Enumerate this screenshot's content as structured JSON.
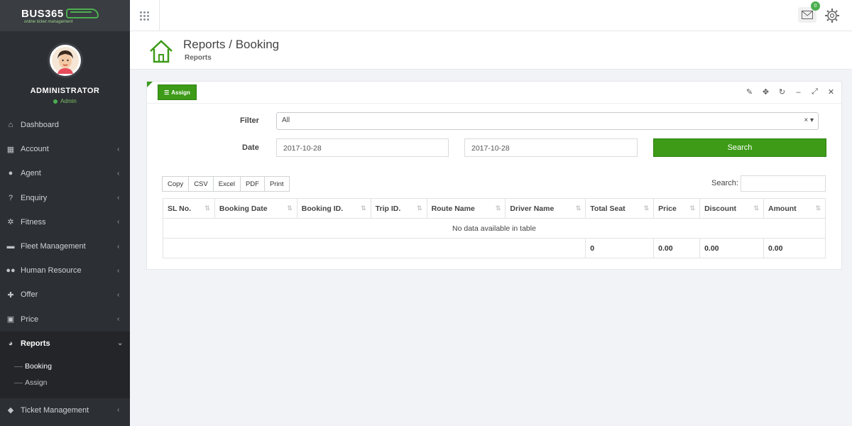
{
  "logo": {
    "name": "BUS365",
    "tagline": "online ticket management"
  },
  "profile": {
    "name": "ADMINISTRATOR",
    "role": "Admin"
  },
  "sidebar": {
    "items": [
      {
        "label": "Dashboard",
        "icon": "home-icon"
      },
      {
        "label": "Account",
        "icon": "calculator-icon"
      },
      {
        "label": "Agent",
        "icon": "user-icon"
      },
      {
        "label": "Enquiry",
        "icon": "question-icon"
      },
      {
        "label": "Fitness",
        "icon": "cog-icon"
      },
      {
        "label": "Fleet Management",
        "icon": "car-icon"
      },
      {
        "label": "Human Resource",
        "icon": "users-icon"
      },
      {
        "label": "Offer",
        "icon": "gift-icon"
      },
      {
        "label": "Price",
        "icon": "money-icon"
      },
      {
        "label": "Reports",
        "icon": "pie-chart-icon"
      }
    ],
    "reports_sub": [
      {
        "label": "Booking"
      },
      {
        "label": "Assign"
      }
    ],
    "ticket": {
      "label": "Ticket Management",
      "icon": "ticket-icon"
    }
  },
  "topbar": {
    "mail_count": "0"
  },
  "header": {
    "title": "Reports / Booking",
    "subtitle": "Reports"
  },
  "panel": {
    "assign_label": "Assign",
    "filter_label": "Filter",
    "filter_value": "All",
    "filter_clear": "×",
    "date_label": "Date",
    "date_from": "2017-10-28",
    "date_to": "2017-10-28",
    "search_button": "Search",
    "export_buttons": [
      "Copy",
      "CSV",
      "Excel",
      "PDF",
      "Print"
    ],
    "search_label": "Search:"
  },
  "table": {
    "headers": [
      "SL No.",
      "Booking Date",
      "Booking ID.",
      "Trip ID.",
      "Route Name",
      "Driver Name",
      "Total Seat",
      "Price",
      "Discount",
      "Amount"
    ],
    "empty_message": "No data available in table",
    "totals": {
      "total_seat": "0",
      "price": "0.00",
      "discount": "0.00",
      "amount": "0.00"
    }
  },
  "colors": {
    "accent": "#3d9b17",
    "sidebar": "#2c2f33"
  }
}
